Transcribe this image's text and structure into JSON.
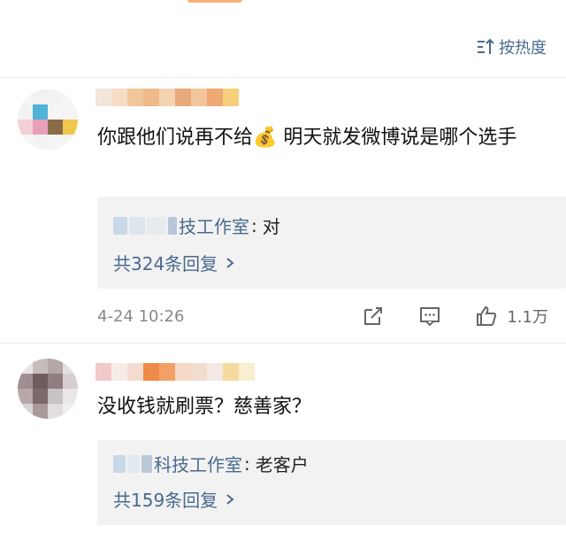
{
  "sort": {
    "label": "按热度"
  },
  "comments": [
    {
      "text": "你跟他们说再不给💰 明天就发微博说是哪个选手",
      "reply": {
        "author": "技工作室",
        "sep": ":",
        "content": "对"
      },
      "more_replies": "共324条回复",
      "time": "4-24 10:26",
      "likes": "1.1万"
    },
    {
      "text": "没收钱就刷票？慈善家？",
      "reply": {
        "author": "科技工作室",
        "sep": ":",
        "content": "老客户"
      },
      "more_replies": "共159条回复"
    }
  ],
  "colors": {
    "link": "#4a6a8f",
    "reply_bg": "#f2f2f2",
    "meta": "#888888"
  }
}
